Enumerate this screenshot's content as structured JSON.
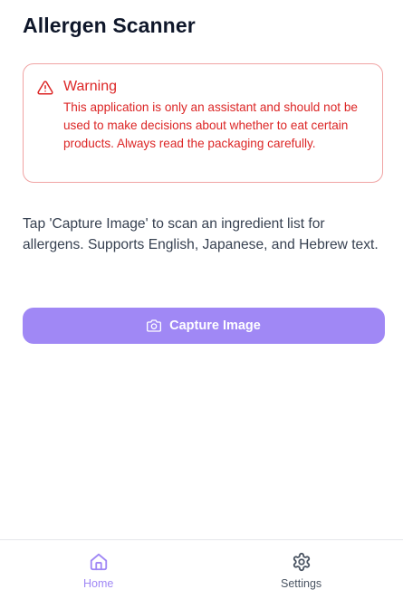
{
  "app": {
    "title": "Allergen Scanner"
  },
  "warning": {
    "icon": "alert-triangle-icon",
    "title": "Warning",
    "text": "This application is only an assistant and should not be used to make decisions about whether to eat certain products. Always read the packaging carefully.",
    "color": "#dc2626",
    "border_color": "#f0a3a3"
  },
  "main": {
    "instructions": "Tap 'Capture Image' to scan an ingredient list for allergens. Supports English, Japanese, and Hebrew text.",
    "capture_button": {
      "label": "Capture Image",
      "icon": "camera-icon",
      "color": "#a088f5"
    }
  },
  "nav": {
    "items": [
      {
        "label": "Home",
        "icon": "home-icon",
        "active": true,
        "color": "#a088f5"
      },
      {
        "label": "Settings",
        "icon": "gear-icon",
        "active": false,
        "color": "#4b5563"
      }
    ]
  }
}
